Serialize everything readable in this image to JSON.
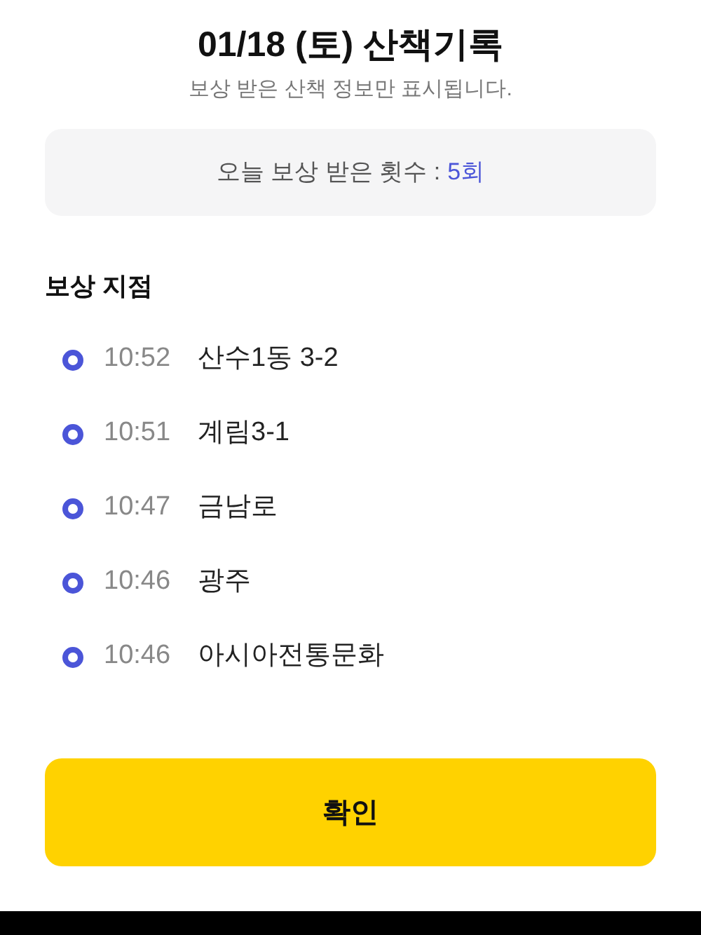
{
  "header": {
    "title": "01/18 (토) 산책기록",
    "subtitle": "보상 받은 산책 정보만 표시됩니다."
  },
  "summary": {
    "label": "오늘 보상 받은 횟수 :",
    "value": "5회"
  },
  "section_title": "보상 지점",
  "points": [
    {
      "time": "10:52",
      "place": "산수1동 3-2"
    },
    {
      "time": "10:51",
      "place": "계림3-1"
    },
    {
      "time": "10:47",
      "place": "금남로"
    },
    {
      "time": "10:46",
      "place": "광주"
    },
    {
      "time": "10:46",
      "place": "아시아전통문화"
    }
  ],
  "confirm_button": "확인"
}
